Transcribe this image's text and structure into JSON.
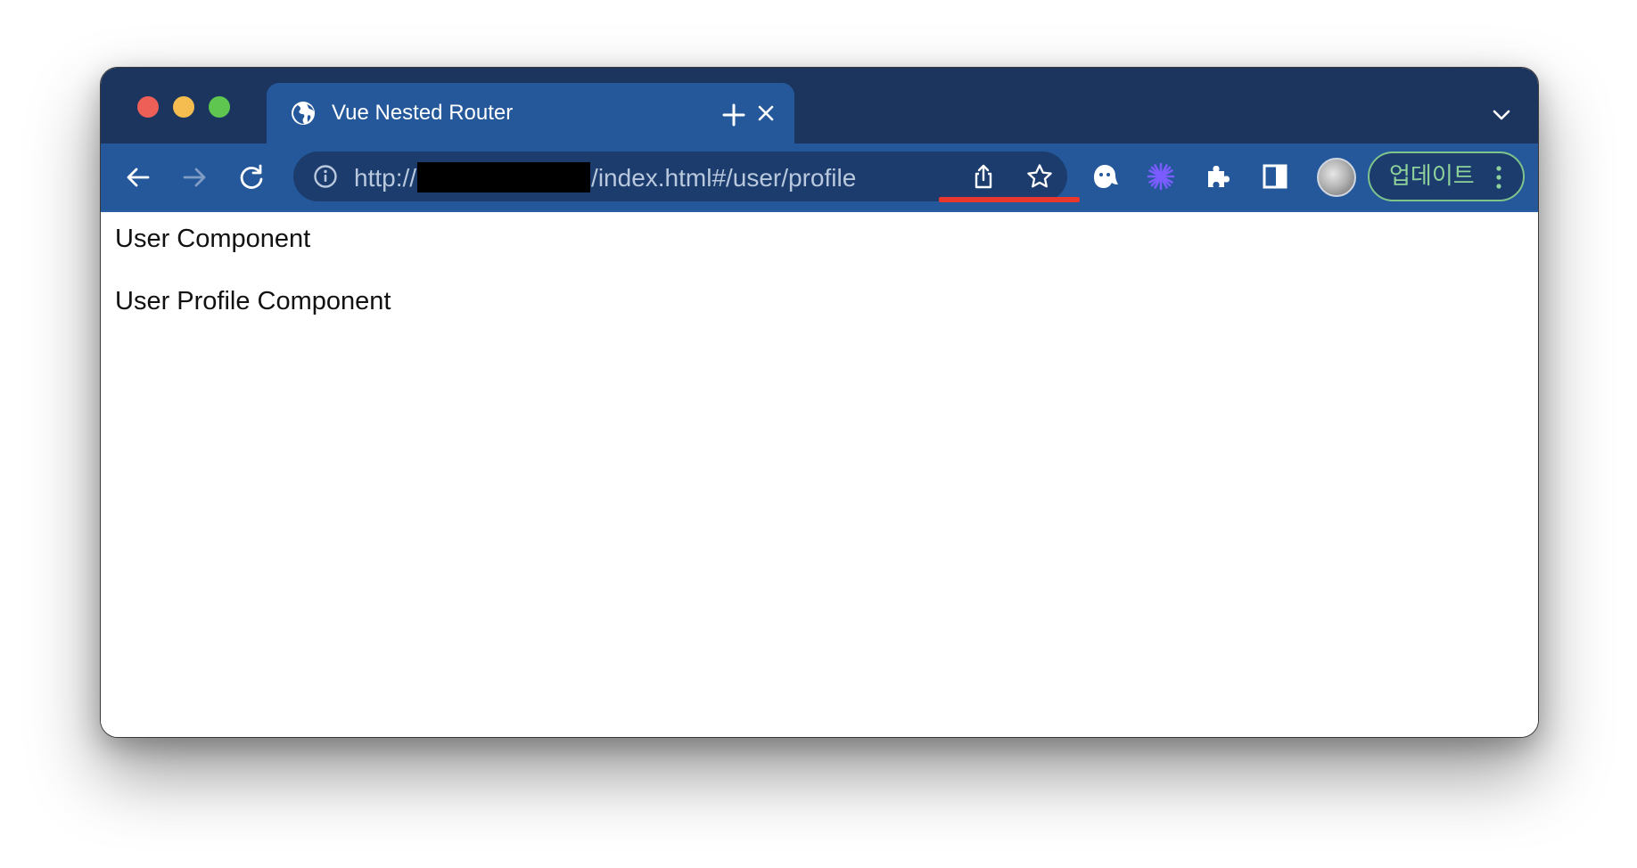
{
  "window": {
    "controls": [
      "close",
      "minimize",
      "zoom"
    ]
  },
  "tab": {
    "favicon": "globe-icon",
    "title": "Vue Nested Router",
    "close_icon": "close-icon"
  },
  "tabstrip": {
    "new_tab_icon": "plus-icon",
    "tab_search_icon": "chevron-down-icon"
  },
  "toolbar": {
    "back_icon": "arrow-left-icon",
    "forward_icon": "arrow-right-icon",
    "reload_icon": "reload-icon",
    "extensions": [
      "ghost-extension-icon",
      "sparkle-extension-icon",
      "puzzle-icon",
      "side-panel-icon"
    ],
    "update_label": "업데이트"
  },
  "omnibox": {
    "url_prefix": "http://",
    "url_suffix": "/index.html#/user/profile",
    "highlight_color": "#e8382e"
  },
  "page": {
    "line1": "User Component",
    "line2": "User Profile Component"
  },
  "colors": {
    "tabstrip": "#1b355e",
    "toolbar": "#24589a",
    "omnibox": "#1b3c6d",
    "update_accent": "#8fd19b"
  }
}
